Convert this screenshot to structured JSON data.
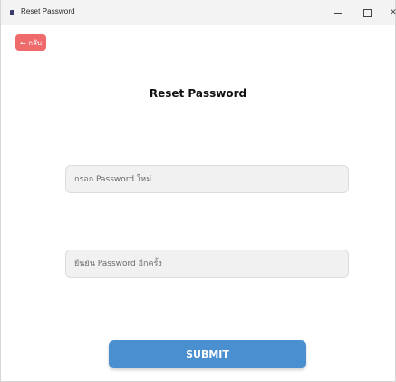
{
  "window": {
    "title": "Reset Password",
    "controls": {
      "minimize": "minimize-icon",
      "maximize": "maximize-icon",
      "close": "close-icon"
    }
  },
  "back_button": {
    "label": "← กลับ",
    "color": "#ef6b6b"
  },
  "page_title": "Reset Password",
  "form": {
    "new_password": {
      "value": "",
      "placeholder": "กรอก Password ใหม่"
    },
    "confirm_password": {
      "value": "",
      "placeholder": "ยืนยัน Password อีกครั้ง"
    },
    "submit_label": "SUBMIT",
    "submit_color": "#4a8fcf"
  }
}
